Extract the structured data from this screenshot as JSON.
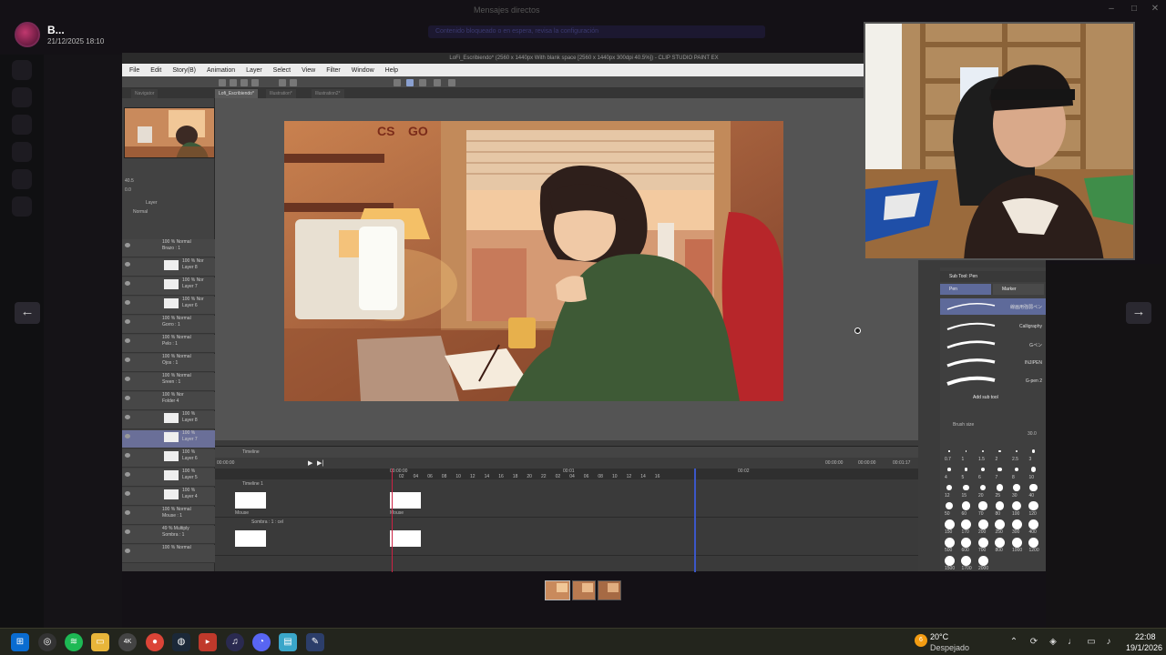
{
  "viewer": {
    "sender": "B...",
    "sent_time": "21/12/2025 18:10",
    "title": "Mensajes directos",
    "banner": "Contenido bloqueado o en espera, revisa la configuración"
  },
  "app": {
    "title": "LoFi_Escribiendo* (2560 x 1440px With blank space [2560 x 1440px 300dpi 40.5%]) - CLIP STUDIO PAINT EX",
    "menu": [
      "File",
      "Edit",
      "Story(B)",
      "Animation",
      "Layer",
      "Select",
      "View",
      "Filter",
      "Window",
      "Help"
    ],
    "tabs": [
      "Navigator",
      "Lofi_Escribiendo*",
      "Illustration*",
      "Illustration2*"
    ],
    "nav_zoom": "40.5",
    "nav_rotate": "0.0",
    "layer_panel_title": "Layer",
    "blend_mode": "Normal"
  },
  "layers": [
    {
      "label": "100 % Normal",
      "name": "Brazo : 1",
      "type": "folder"
    },
    {
      "label": "100 % Nor",
      "name": "Layer 8",
      "type": "layer"
    },
    {
      "label": "100 % Nor",
      "name": "Layer 7",
      "type": "layer"
    },
    {
      "label": "100 % Nor",
      "name": "Layer 6",
      "type": "layer"
    },
    {
      "label": "100 % Normal",
      "name": "Gorro : 1",
      "type": "folder"
    },
    {
      "label": "100 % Normal",
      "name": "Pelo : 1",
      "type": "folder"
    },
    {
      "label": "100 % Normal",
      "name": "Ojos : 1",
      "type": "folder"
    },
    {
      "label": "100 % Normal",
      "name": "Sreen : 1",
      "type": "folder"
    },
    {
      "label": "100 % Nor",
      "name": "Folder 4",
      "type": "folder"
    },
    {
      "label": "100 %",
      "name": "Layer 8",
      "type": "layer"
    },
    {
      "label": "100 %",
      "name": "Layer 7",
      "type": "layer",
      "selected": true
    },
    {
      "label": "100 %",
      "name": "Layer 6",
      "type": "layer"
    },
    {
      "label": "100 %",
      "name": "Layer 5",
      "type": "layer"
    },
    {
      "label": "100 %",
      "name": "Layer 4",
      "type": "layer"
    },
    {
      "label": "100 % Normal",
      "name": "Mouse : 1",
      "type": "folder"
    },
    {
      "label": "49 % Multiply",
      "name": "Sombra : 1",
      "type": "folder"
    },
    {
      "label": "100 % Normal",
      "name": "",
      "type": "folder"
    }
  ],
  "timeline": {
    "tab": "Timeline",
    "track1": "Timeline 1",
    "track2": "Sombra : 1 : cel",
    "cel_label": "Mouse",
    "start_time": "00:00:00",
    "ruler_start": "00:00:00",
    "ruler_mid": "00:01",
    "ruler_end": "00:02",
    "time_a": "00:00:00",
    "time_b": "00:00:00",
    "time_c": "00:01:17",
    "ticks": [
      "02",
      "04",
      "06",
      "08",
      "10",
      "12",
      "14",
      "16",
      "18",
      "20",
      "22",
      "02",
      "04",
      "06",
      "08",
      "10",
      "12",
      "14",
      "16"
    ]
  },
  "subtool": {
    "title": "Sub Tool: Pen",
    "tab_pen": "Pen",
    "tab_marker": "Marker",
    "brushes": [
      "線画用強弱ペン",
      "Calligraphy",
      "Gペン",
      "INJIPEN",
      "G-pen 2"
    ],
    "add_sub_tool": "Add sub tool",
    "brush_size_title": "Brush size",
    "brush_size_value": "30.0",
    "sizes": [
      "0.7",
      "1",
      "1.5",
      "2",
      "2.5",
      "3",
      "4",
      "5",
      "6",
      "7",
      "8",
      "10",
      "12",
      "15",
      "20",
      "25",
      "30",
      "40",
      "50",
      "60",
      "70",
      "80",
      "100",
      "120",
      "150",
      "170",
      "200",
      "250",
      "300",
      "400",
      "500",
      "600",
      "700",
      "800",
      "1000",
      "1200",
      "1500",
      "1700",
      "2000"
    ]
  },
  "taskbar": {
    "weather_badge": "6",
    "temperature": "20°C",
    "weather": "Despejado",
    "time": "22:08",
    "date": "19/1/2026",
    "apps": [
      "start-icon",
      "obs-icon",
      "spotify-icon",
      "file-explorer-icon",
      "4k-downloader-icon",
      "chrome-icon",
      "steam-icon",
      "video-editor-icon",
      "audio-app-icon",
      "discord-icon",
      "notepad-icon",
      "clip-studio-icon"
    ]
  },
  "colors": {
    "accent": "#6a6f98",
    "menu_bg": "#ececec",
    "panel_bg": "#424242",
    "playhead": "#cc2244"
  }
}
